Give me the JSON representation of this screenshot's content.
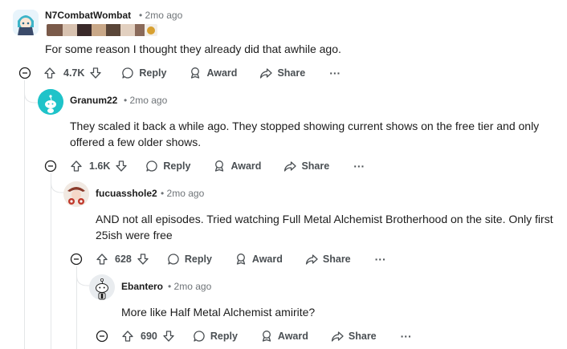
{
  "comments": [
    {
      "username": "N7CombatWombat",
      "time": "2mo ago",
      "text": "For some reason I thought they already did that awhile ago.",
      "score": "4.7K",
      "reply_label": "Reply",
      "award_label": "Award",
      "share_label": "Share",
      "more_label": "···"
    },
    {
      "username": "Granum22",
      "time": "2mo ago",
      "text_line1": "They scaled it back a while ago.  They stopped showing current shows on the free tier and only",
      "text_line2": "offered a few older shows.",
      "score": "1.6K",
      "reply_label": "Reply",
      "award_label": "Award",
      "share_label": "Share",
      "more_label": "···"
    },
    {
      "username": "fucuasshole2",
      "time": "2mo ago",
      "text_line1": "AND not all episodes. Tried watching Full Metal Alchemist Brotherhood on the site. Only first",
      "text_line2": "25ish were free",
      "score": "628",
      "reply_label": "Reply",
      "award_label": "Award",
      "share_label": "Share",
      "more_label": "···"
    },
    {
      "username": "Ebantero",
      "time": "2mo ago",
      "text": "More like Half Metal Alchemist amirite?",
      "score": "690",
      "reply_label": "Reply",
      "award_label": "Award",
      "share_label": "Share",
      "more_label": "···"
    }
  ],
  "separator": "•",
  "colors": {
    "text": "#1c1c1c",
    "meta": "#6f7478",
    "thread_line": "#e4e6e8",
    "action": "#4a4f53",
    "avatar_teal": "#1fc3c9"
  }
}
